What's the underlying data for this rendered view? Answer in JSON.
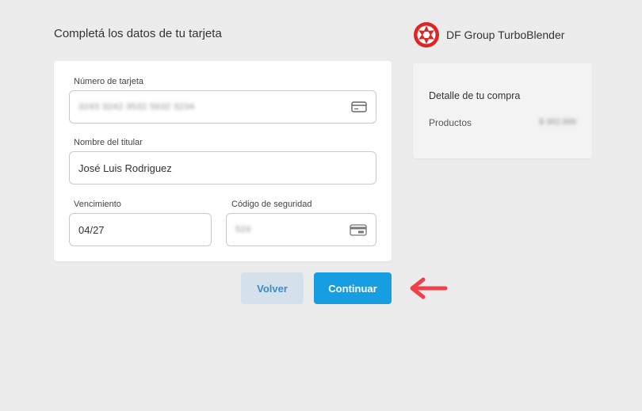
{
  "page": {
    "title": "Completá los datos de tu tarjeta"
  },
  "brand": {
    "name": "DF Group TurboBlender",
    "logo_color": "#e02424"
  },
  "form": {
    "card_number": {
      "label": "Número de tarjeta",
      "value": "3243 3242 3532 5632 3234",
      "icon": "credit-card-icon"
    },
    "holder_name": {
      "label": "Nombre del titular",
      "value": "José Luis Rodriguez"
    },
    "expiry": {
      "label": "Vencimiento",
      "value": "04/27"
    },
    "security_code": {
      "label": "Código de seguridad",
      "value": "524",
      "icon": "card-back-icon"
    }
  },
  "summary": {
    "title": "Detalle de tu compra",
    "products_label": "Productos",
    "products_amount": "$ 362.999"
  },
  "actions": {
    "back_label": "Volver",
    "continue_label": "Continuar"
  },
  "colors": {
    "primary": "#169ee0",
    "secondary_bg": "#d5e1ea",
    "arrow": "#f0404a",
    "page_bg": "#ececec"
  }
}
